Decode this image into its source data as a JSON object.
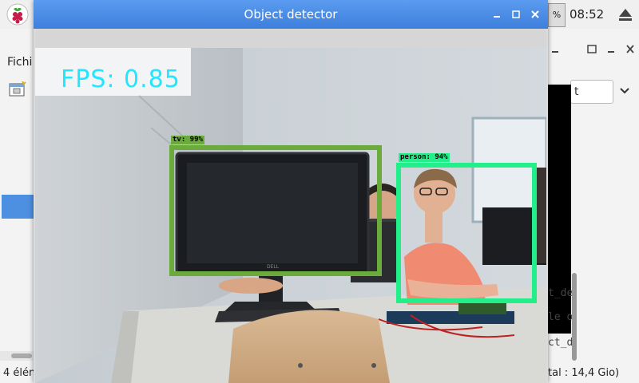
{
  "taskbar": {
    "logo_icon": "raspberry-pi-logo",
    "cpu_label": "%",
    "clock": "08:52",
    "eject_icon": "eject-icon"
  },
  "file_manager": {
    "menu_label": "Fichi",
    "status": "4 élén"
  },
  "right_window": {
    "select_value": "t",
    "lines": [
      "t_de",
      "le o",
      "ct_d"
    ],
    "status": "tal : 14,4 Gio)"
  },
  "detector": {
    "title": "Object detector",
    "fps": "FPS: 0.85",
    "detections": [
      {
        "label": "tv: 99%",
        "color": "#6aab3c"
      },
      {
        "label": "person: 94%",
        "color": "#22ef8a"
      }
    ]
  }
}
